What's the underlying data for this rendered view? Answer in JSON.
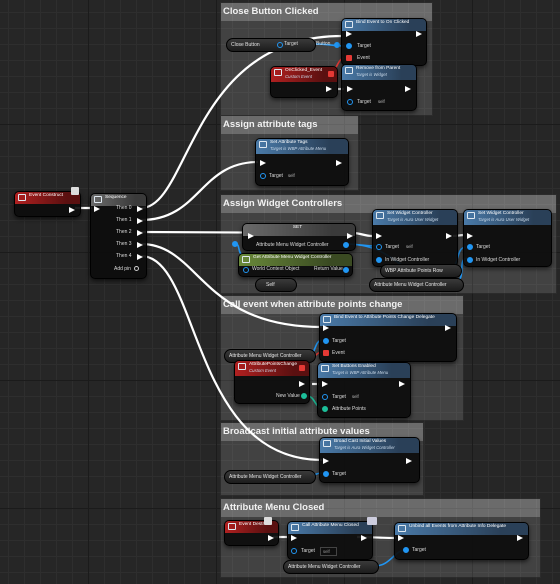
{
  "comments": {
    "close_button_clicked": "Close Button Clicked",
    "assign_attribute_tags": "Assign attribute tags",
    "assign_widget_controllers": "Assign Widget Controllers",
    "call_event_attribute_points": "Call event when attribute points change",
    "broadcast_initial_values": "Broadcast initial attribute values",
    "attribute_menu_closed": "Attribute Menu Closed"
  },
  "event_construct": {
    "title": "Event Construct"
  },
  "sequence": {
    "title": "Sequence",
    "outputs": [
      "Then 0",
      "Then 1",
      "Then 2",
      "Then 3",
      "Then 4"
    ],
    "add_pin": "Add pin"
  },
  "close_section": {
    "close_button_var": "Close Button",
    "close_button_target": "Target",
    "close_button_out": "Button",
    "bind_title": "Bind Event to On Clicked",
    "bind_target": "Target",
    "bind_event": "Event",
    "onclicked_title": "OnClicked_Event",
    "onclicked_sub": "Custom Event",
    "remove_title": "Remove from Parent",
    "remove_sub": "Target is Widget",
    "remove_target": "Target",
    "remove_self": "self"
  },
  "tags_section": {
    "title": "Set Attribute Tags",
    "sub": "Target is WBP Attribute Menu",
    "target": "Target",
    "self": "self"
  },
  "controllers_section": {
    "set_title": "SET",
    "set_var": "Attribute Menu Widget Controller",
    "get_title": "Get Attribute Menu Widget Controller",
    "world_context": "World Context Object",
    "return_value": "Return Value",
    "self_var": "Self",
    "swc1_title": "Set Widget Controller",
    "swc1_sub": "Target is Aura User Widget",
    "swc1_target": "Target",
    "swc1_self": "self",
    "swc1_in": "In Widget Controller",
    "points_row_var": "WBP Attribute Points Row",
    "amwc_var": "Attribute Menu Widget Controller",
    "swc2_title": "Set Widget Controller",
    "swc2_sub": "Target is Aura User Widget",
    "swc2_target": "Target",
    "swc2_in": "In Widget Controller"
  },
  "points_section": {
    "bind_title": "Bind Event to Attribute Points Change Delegate",
    "bind_target": "Target",
    "bind_event": "Event",
    "amwc_var": "Attribute Menu Widget Controller",
    "custom_title": "AttributePointsChange",
    "custom_sub": "Custom Event",
    "new_value": "New Value",
    "setbtn_title": "Set Buttons Enabled",
    "setbtn_sub": "Target is WBP Attribute Menu",
    "setbtn_target": "Target",
    "setbtn_self": "self",
    "setbtn_points": "Attribute Points"
  },
  "broadcast_section": {
    "title": "Broad Cast Initial Values",
    "sub": "Target is Aura Widget Controller",
    "target": "Target",
    "amwc_var": "Attribute Menu Widget Controller"
  },
  "closed_section": {
    "destruct_title": "Event Destruct",
    "call_title": "Call Attribute Menu Closed",
    "call_target": "Target",
    "call_self": "self",
    "unbind_title": "Unbind all Events from Attribute Info Delegate",
    "unbind_target": "Target",
    "amwc_var": "Attribute Menu Widget Controller"
  },
  "colors": {
    "exec_wire": "#ffffff",
    "object_wire": "#2196f3",
    "delegate_wire": "#e53935",
    "int_wire": "#1cbf9a",
    "node_header_blue": "#4a7aa8",
    "event_header_red": "#b02020"
  }
}
